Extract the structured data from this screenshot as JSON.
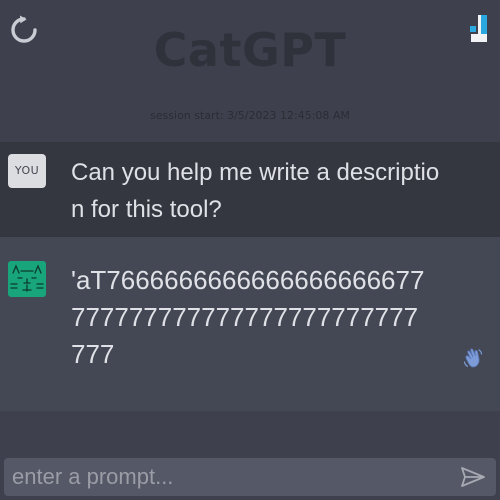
{
  "header": {
    "title": "CatGPT",
    "refresh_icon": "refresh-icon",
    "logo_icon": "brand-logo-icon"
  },
  "session": {
    "label": "session start: 3/5/2023 12:45:08 AM"
  },
  "messages": [
    {
      "role": "user",
      "avatar_label": "YOU",
      "text": "Can you help me write a description for this tool?"
    },
    {
      "role": "assistant",
      "avatar_icon": "cat-face-icon",
      "text": "'aT7666666666666666666677777777777777777777777777777",
      "action_icon": "waving-hand-icon"
    }
  ],
  "input": {
    "placeholder": "enter a prompt...",
    "value": "",
    "send_icon": "send-icon"
  },
  "colors": {
    "background": "#3e414d",
    "user_row": "#343640",
    "assistant_row": "#444754",
    "cat_avatar": "#19a57c",
    "logo_accent": "#2aa9e0"
  }
}
